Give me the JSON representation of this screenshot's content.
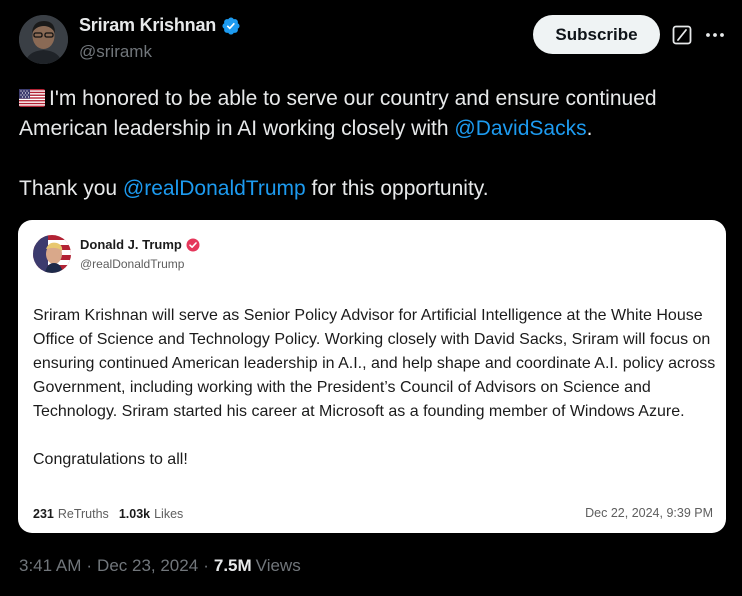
{
  "author": {
    "name": "Sriram Krishnan",
    "handle": "@sriramk",
    "verified": true,
    "verified_color": "#1d9bf0"
  },
  "actions": {
    "subscribe_label": "Subscribe",
    "grok_icon": "grok-icon",
    "more_icon": "more-icon"
  },
  "tweet": {
    "flag_icon": "us-flag-icon",
    "line1_pre": "I'm honored to be able to serve our country and ensure continued American leadership in AI working closely with ",
    "line1_mention": "@DavidSacks",
    "line1_post": ".",
    "line2_pre": "Thank you ",
    "line2_mention": "@realDonaldTrump",
    "line2_post": " for this opportunity.",
    "mention_color": "#1d9bf0"
  },
  "quote": {
    "name": "Donald J. Trump",
    "handle": "@realDonaldTrump",
    "badge_color": "#e5375b",
    "body_p1": "Sriram Krishnan will serve as Senior Policy Advisor for Artificial Intelligence at the White House Office of Science and Technology Policy. Working closely with David Sacks, Sriram will focus on ensuring continued American leadership in A.I., and help shape and coordinate A.I. policy across Government, including working with the President’s Council of Advisors on Science and Technology. Sriram started his career at Microsoft as a founding member of Windows Azure.",
    "body_p2": "Congratulations to all!",
    "retruths_count": "231",
    "retruths_label": "ReTruths",
    "likes_count": "1.03k",
    "likes_label": "Likes",
    "date": "Dec 22, 2024, 9:39 PM"
  },
  "meta": {
    "time": "3:41 AM",
    "sep1": "·",
    "date": "Dec 23, 2024",
    "sep2": "·",
    "views_count": "7.5M",
    "views_label": "Views"
  }
}
